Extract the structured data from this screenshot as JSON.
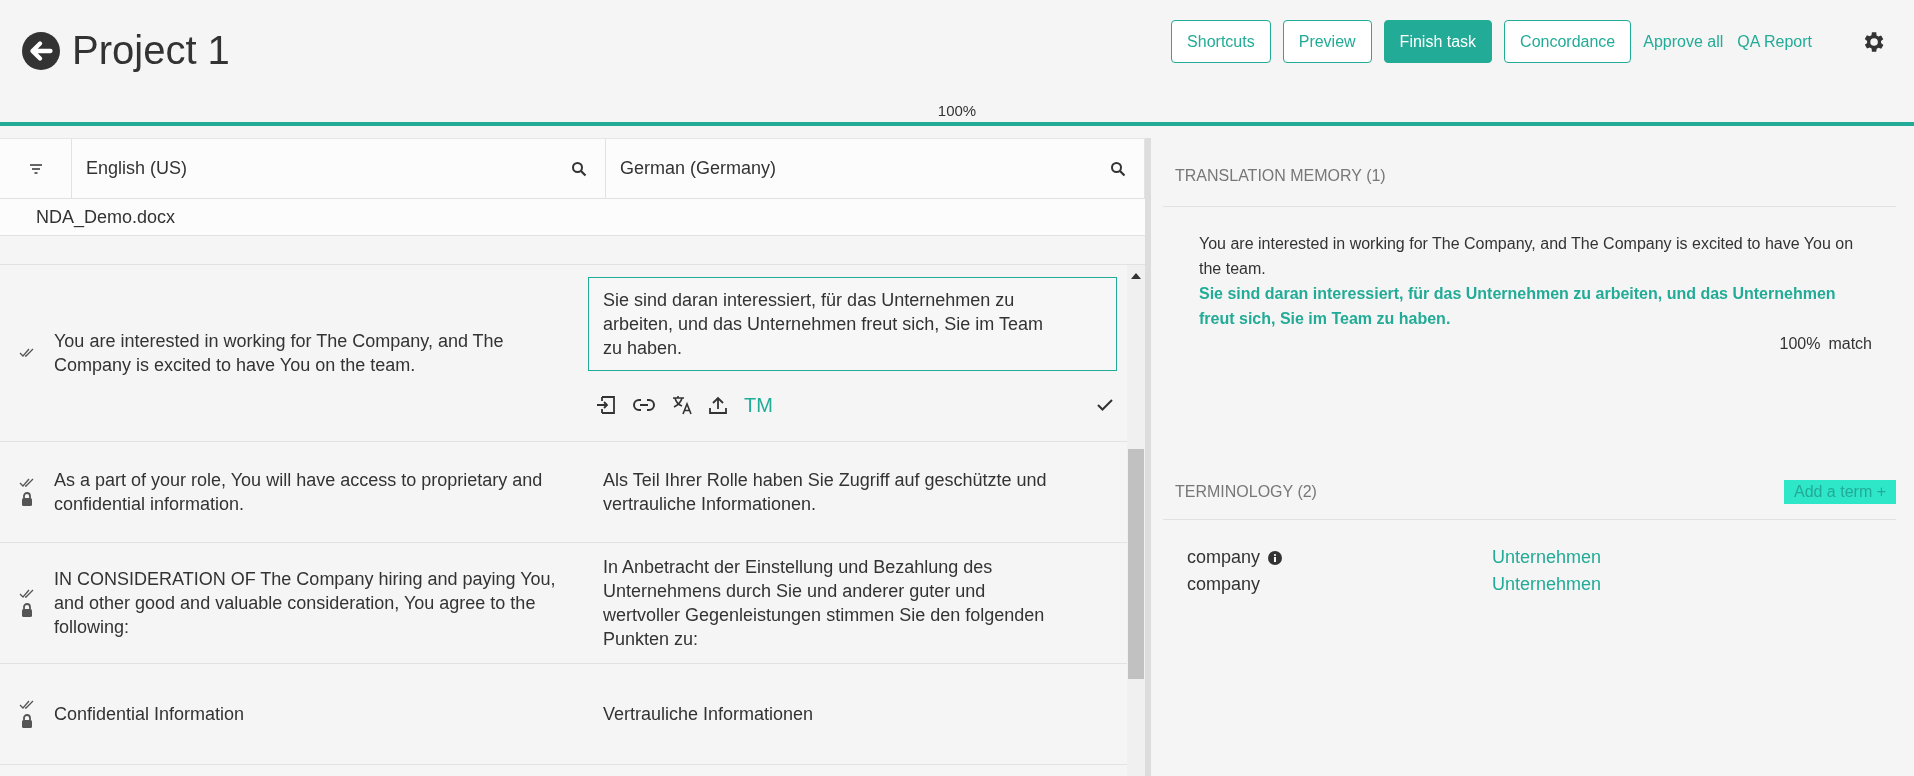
{
  "header": {
    "title": "Project 1",
    "buttons": [
      {
        "label": "Shortcuts",
        "kind": "outline"
      },
      {
        "label": "Preview",
        "kind": "outline"
      },
      {
        "label": "Finish task",
        "kind": "primary"
      },
      {
        "label": "Concordance",
        "kind": "outline"
      },
      {
        "label": "Approve all",
        "kind": "link"
      },
      {
        "label": "QA Report",
        "kind": "link"
      }
    ]
  },
  "progress": {
    "label": "100%",
    "level": 1
  },
  "editor": {
    "source_language": "English (US)",
    "target_language": "German (Germany)",
    "file": "NDA_Demo.docx",
    "segments": [
      {
        "source": "You are interested in working for The Company, and The Company is excited to have You on the team.",
        "target": "Sie sind daran interessiert, für das Unternehmen zu arbeiten, und das Unternehmen freut sich, Sie im Team zu haben.",
        "confirmed": true,
        "locked": false,
        "editing": true,
        "tool_label": "TM"
      },
      {
        "source": "As a part of your role, You will have access to proprietary and confidential information.",
        "target": "Als Teil Ihrer Rolle haben Sie Zugriff auf geschützte und vertrauliche Informationen.",
        "confirmed": true,
        "locked": true,
        "editing": false
      },
      {
        "source": "IN CONSIDERATION OF The Company hiring and paying You, and other good and valuable consideration, You agree to the following:",
        "target": "In Anbetracht der Einstellung und Bezahlung des Unternehmens durch Sie und anderer guter und wertvoller Gegenleistungen stimmen Sie den folgenden Punkten zu:",
        "confirmed": true,
        "locked": true,
        "editing": false
      },
      {
        "source": "Confidential Information",
        "target": "Vertrauliche Informationen",
        "confirmed": true,
        "locked": true,
        "editing": false
      }
    ]
  },
  "translation_memory": {
    "title": "TRANSLATION MEMORY (1)",
    "source": "You are interested in working for The Company, and The Company is excited to have You on the team.",
    "target": "Sie sind daran interessiert, für das Unternehmen zu arbeiten, und das Unternehmen freut sich, Sie im Team zu haben.",
    "match": "100%",
    "match_label": "match"
  },
  "terminology": {
    "title": "TERMINOLOGY (2)",
    "add_label": "Add a term",
    "add_icon": "+",
    "terms": [
      {
        "source": "company",
        "target": "Unternehmen",
        "info": true
      },
      {
        "source": "company",
        "target": "Unternehmen",
        "info": false
      }
    ]
  }
}
